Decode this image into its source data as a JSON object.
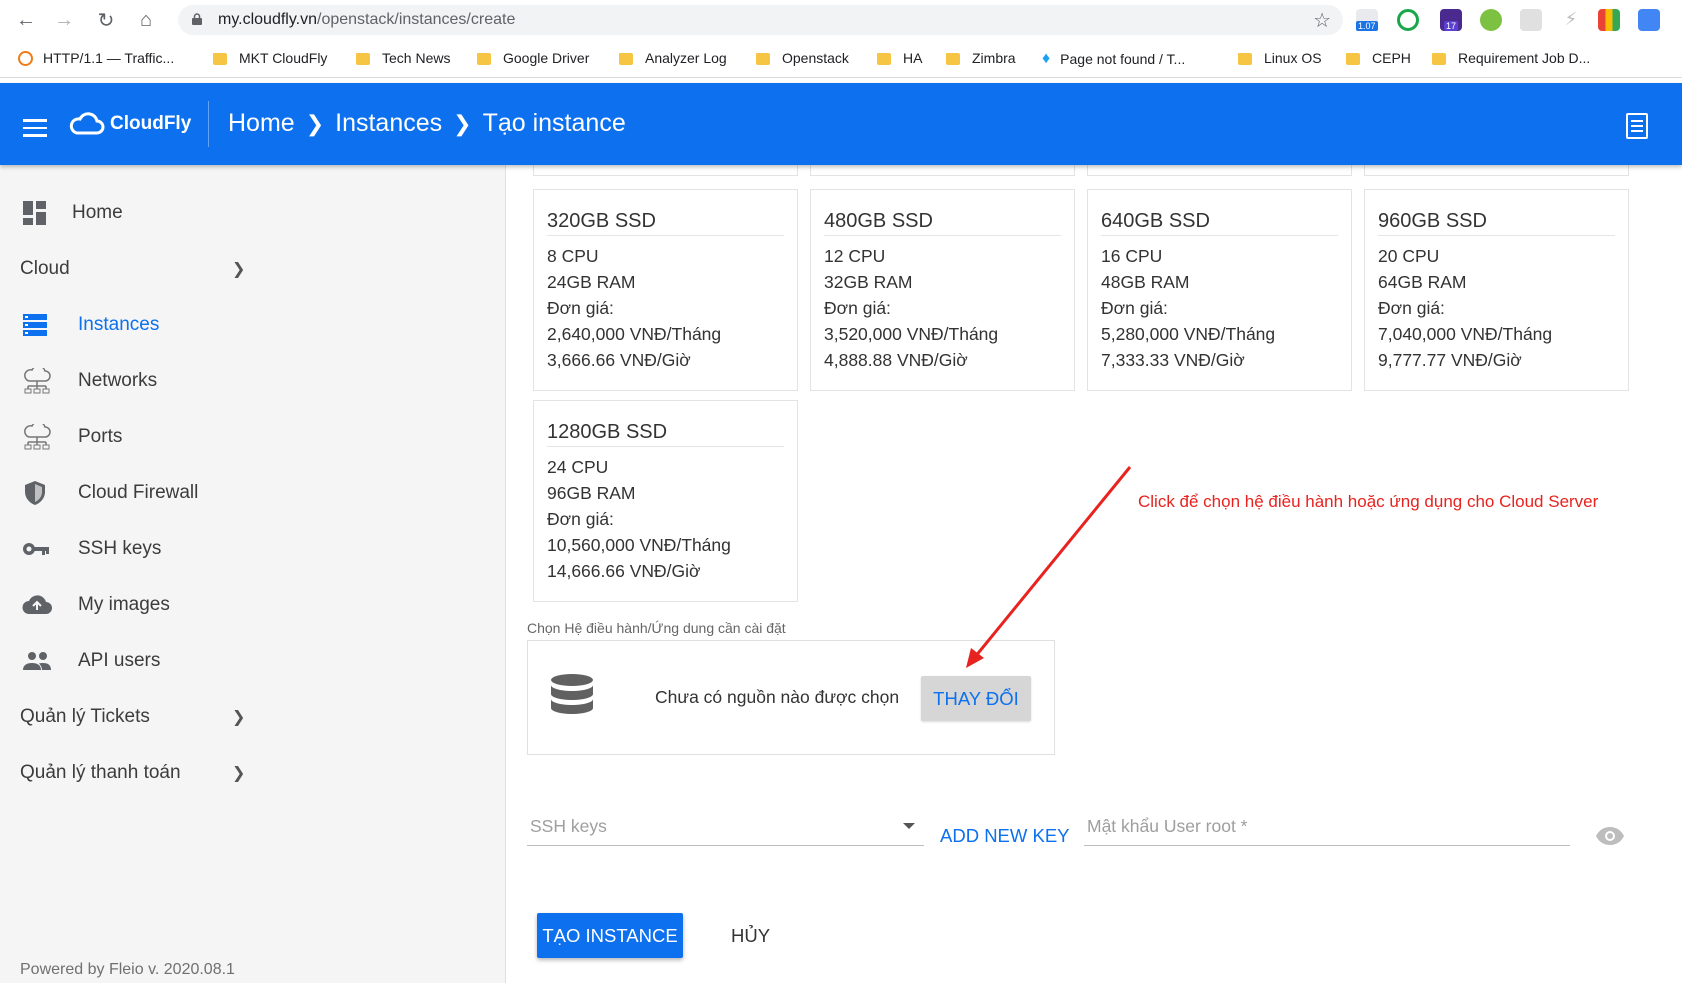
{
  "browser": {
    "url_host": "my.cloudfly.vn",
    "url_path": "/openstack/instances/create",
    "extension_badges": [
      "1.07",
      "17"
    ],
    "bookmarks": [
      "HTTP/1.1 — Traffic...",
      "MKT CloudFly",
      "Tech News",
      "Google Driver",
      "Analyzer Log",
      "Openstack",
      "HA",
      "Zimbra",
      "Page not found / T...",
      "Linux OS",
      "CEPH",
      "Requirement Job D..."
    ]
  },
  "header": {
    "logo_text": "CloudFly",
    "breadcrumb": [
      "Home",
      "Instances",
      "Tạo instance"
    ],
    "brand_color": "#0d70ee"
  },
  "sidebar": {
    "items": [
      {
        "label": "Home",
        "icon": "dashboard-icon"
      },
      {
        "label": "Cloud",
        "icon": "chevron-down-icon"
      },
      {
        "label": "Instances",
        "icon": "server-list-icon"
      },
      {
        "label": "Networks",
        "icon": "cloud-network-icon"
      },
      {
        "label": "Ports",
        "icon": "cloud-network-icon"
      },
      {
        "label": "Cloud Firewall",
        "icon": "shield-icon"
      },
      {
        "label": "SSH keys",
        "icon": "key-icon"
      },
      {
        "label": "My images",
        "icon": "cloud-upload-icon"
      },
      {
        "label": "API users",
        "icon": "people-icon"
      },
      {
        "label": "Quản lý Tickets",
        "icon": "chevron-right-icon"
      },
      {
        "label": "Quản lý thanh toán",
        "icon": "chevron-right-icon"
      }
    ],
    "active": "Instances",
    "footer": "Powered by Fleio v. 2020.08.1"
  },
  "flavors": [
    {
      "title": "320GB SSD",
      "cpu": "8 CPU",
      "ram": "24GB RAM",
      "price_label": "Đơn giá:",
      "monthly": "2,640,000 VNĐ/Tháng",
      "hourly": "3,666.66 VNĐ/Giờ"
    },
    {
      "title": "480GB SSD",
      "cpu": "12 CPU",
      "ram": "32GB RAM",
      "price_label": "Đơn giá:",
      "monthly": "3,520,000 VNĐ/Tháng",
      "hourly": "4,888.88 VNĐ/Giờ"
    },
    {
      "title": "640GB SSD",
      "cpu": "16 CPU",
      "ram": "48GB RAM",
      "price_label": "Đơn giá:",
      "monthly": "5,280,000 VNĐ/Tháng",
      "hourly": "7,333.33 VNĐ/Giờ"
    },
    {
      "title": "960GB SSD",
      "cpu": "20 CPU",
      "ram": "64GB RAM",
      "price_label": "Đơn giá:",
      "monthly": "7,040,000 VNĐ/Tháng",
      "hourly": "9,777.77 VNĐ/Giờ"
    },
    {
      "title": "1280GB SSD",
      "cpu": "24 CPU",
      "ram": "96GB RAM",
      "price_label": "Đơn giá:",
      "monthly": "10,560,000 VNĐ/Tháng",
      "hourly": "14,666.66 VNĐ/Giờ"
    }
  ],
  "image_source": {
    "label": "Chọn Hệ điều hành/Ứng dung cần cài đặt",
    "status": "Chưa có nguồn nào được chọn",
    "change_button": "THAY ĐỔI"
  },
  "form": {
    "ssh_placeholder": "SSH keys",
    "add_key": "ADD NEW KEY",
    "password_placeholder": "Mật khẩu User root *",
    "submit": "TẠO INSTANCE",
    "cancel": "HỦY"
  },
  "annotation": {
    "text": "Click để chọn hệ điều hành hoặc ứng dụng cho Cloud Server",
    "color": "#e8231f"
  }
}
